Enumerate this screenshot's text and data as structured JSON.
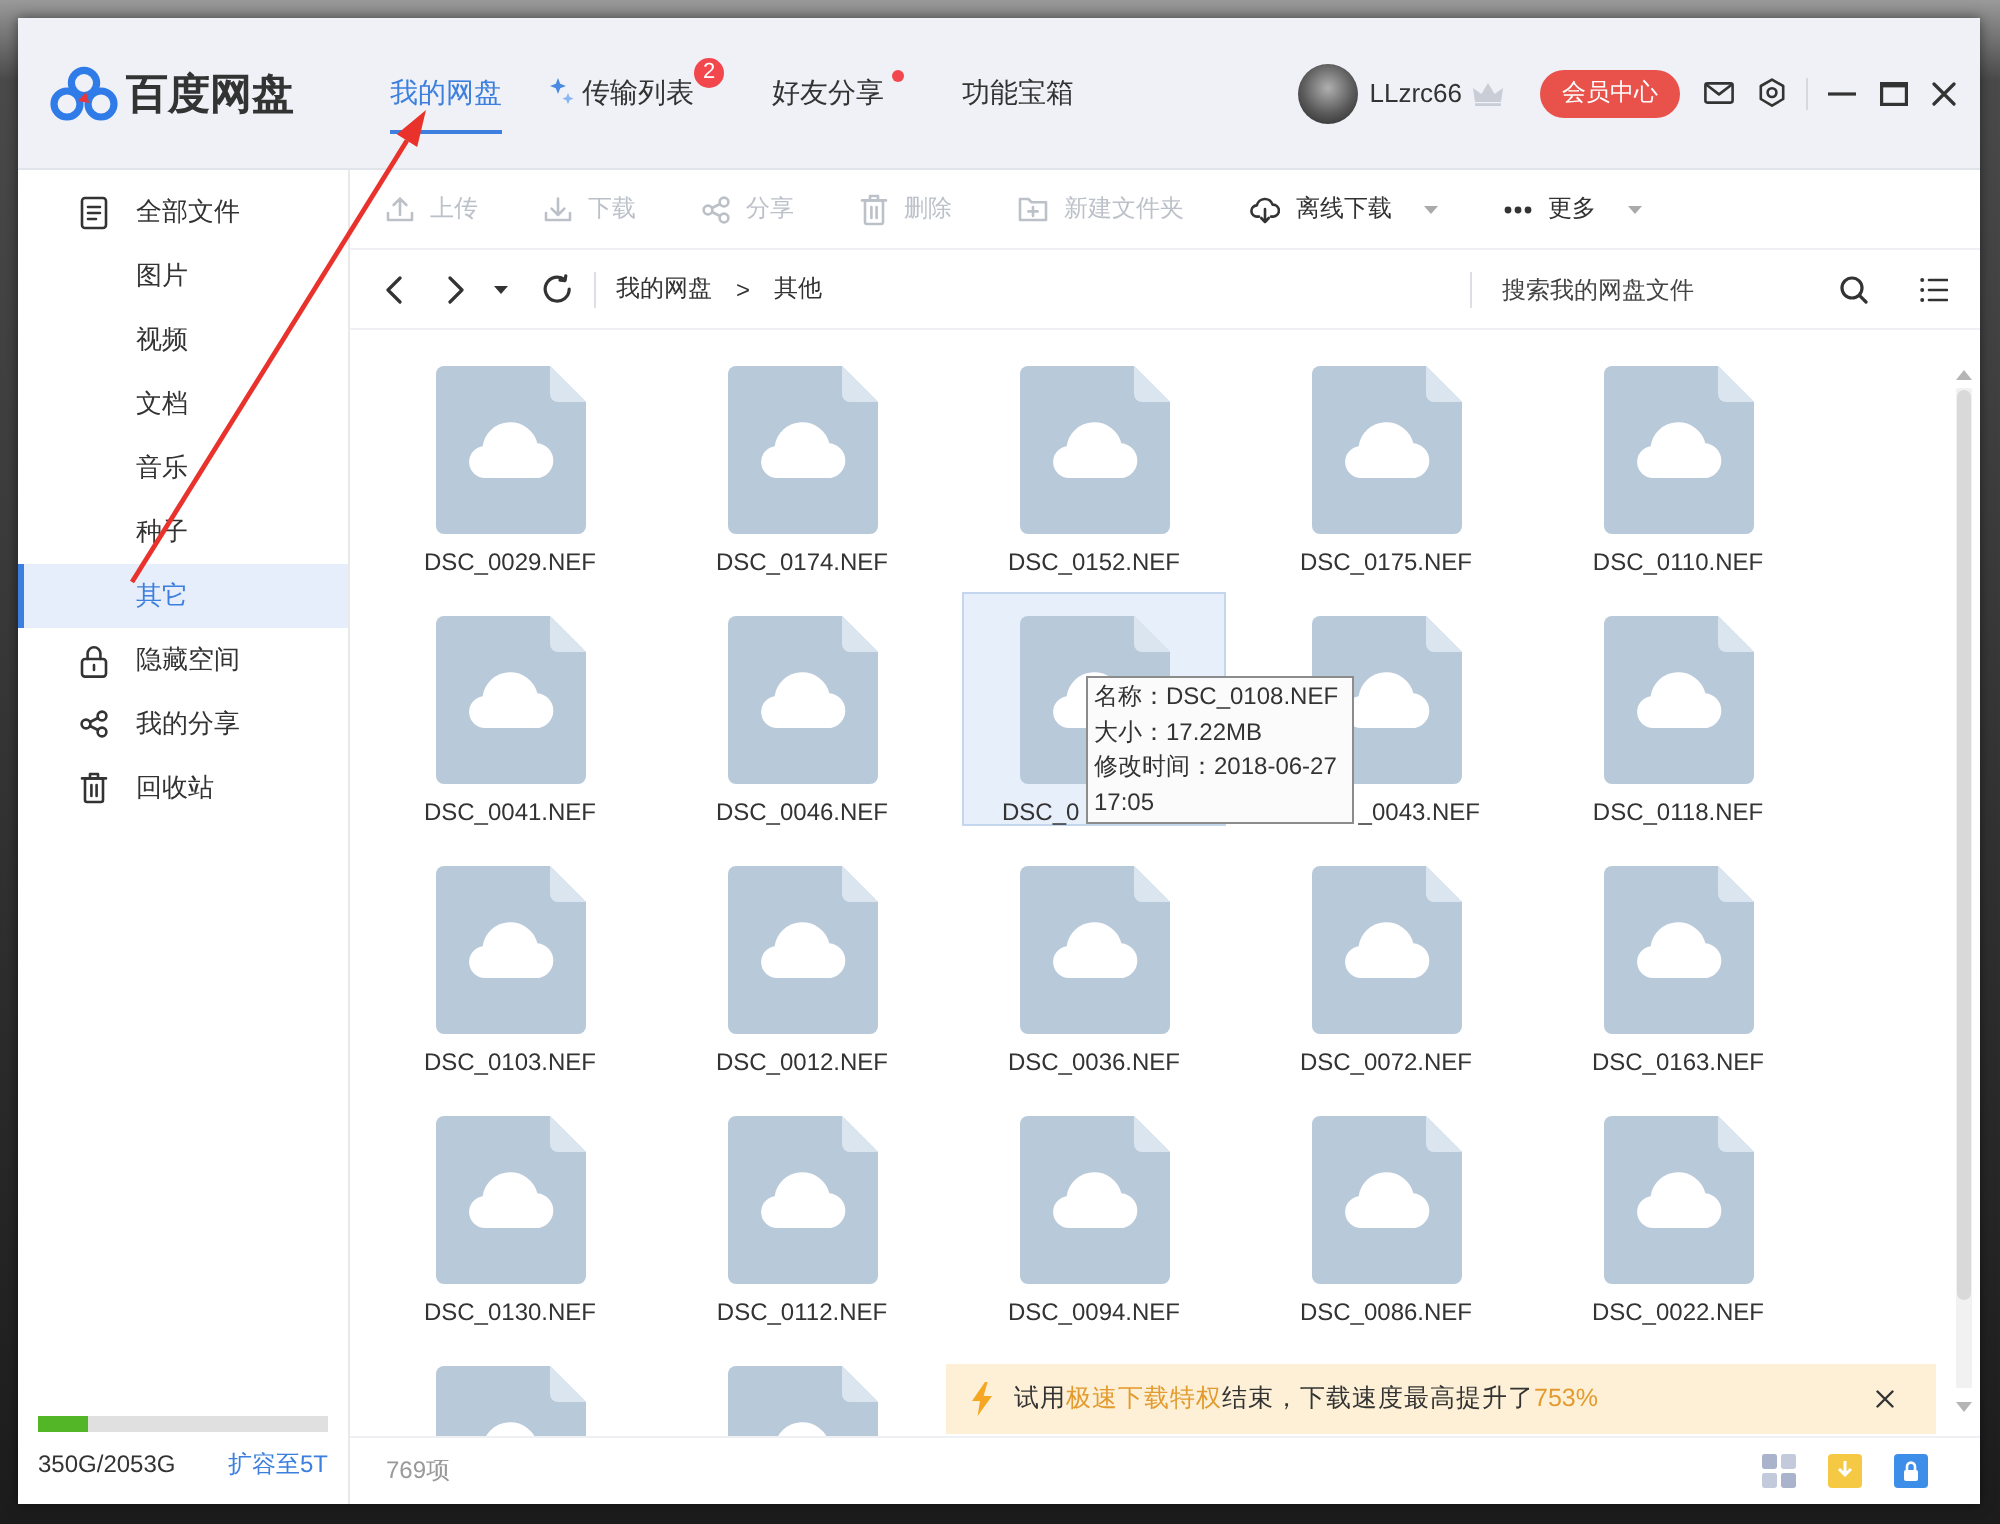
{
  "header": {
    "logo": "百度网盘",
    "tabs": [
      {
        "label": "我的网盘",
        "selected": true,
        "icon": false,
        "dot": false
      },
      {
        "label": "传输列表",
        "selected": false,
        "icon": true,
        "badge": "2",
        "dot": false
      },
      {
        "label": "好友分享",
        "selected": false,
        "icon": false,
        "dot": true
      },
      {
        "label": "功能宝箱",
        "selected": false,
        "icon": false,
        "dot": false
      }
    ],
    "user": {
      "name": "LLzrc66"
    },
    "vip_button": "会员中心"
  },
  "sidebar": {
    "items": [
      {
        "label": "全部文件",
        "selected": false,
        "children": [
          {
            "label": "图片",
            "selected": false
          },
          {
            "label": "视频",
            "selected": false
          },
          {
            "label": "文档",
            "selected": false
          },
          {
            "label": "音乐",
            "selected": false
          },
          {
            "label": "种子",
            "selected": false
          },
          {
            "label": "其它",
            "selected": true
          }
        ]
      },
      {
        "label": "隐藏空间",
        "selected": false
      },
      {
        "label": "我的分享",
        "selected": false
      },
      {
        "label": "回收站",
        "selected": false
      }
    ],
    "storage": {
      "level": 0.17,
      "usage": "350G/2053G",
      "upgrade_link": "扩容至5T"
    }
  },
  "toolbar": [
    {
      "label": "上传",
      "disabled": true,
      "dropdown": false
    },
    {
      "label": "下载",
      "disabled": true,
      "dropdown": false
    },
    {
      "label": "分享",
      "disabled": true,
      "dropdown": false
    },
    {
      "label": "删除",
      "disabled": true,
      "dropdown": false
    },
    {
      "label": "新建文件夹",
      "disabled": true,
      "dropdown": false
    },
    {
      "label": "离线下载",
      "disabled": false,
      "dropdown": true
    },
    {
      "label": "更多",
      "disabled": false,
      "dropdown": true
    }
  ],
  "navigation": {
    "breadcrumb": [
      "我的网盘",
      "其他"
    ],
    "separator": ">",
    "search": {
      "placeholder": "搜索我的网盘文件"
    }
  },
  "files": [
    {
      "name": "DSC_0029.NEF",
      "hovered": false
    },
    {
      "name": "DSC_0174.NEF",
      "hovered": false
    },
    {
      "name": "DSC_0152.NEF",
      "hovered": false
    },
    {
      "name": "DSC_0175.NEF",
      "hovered": false
    },
    {
      "name": "DSC_0110.NEF",
      "hovered": false
    },
    {
      "name": "DSC_0041.NEF",
      "hovered": false
    },
    {
      "name": "DSC_0046.NEF",
      "hovered": false
    },
    {
      "name": "DSC_0",
      "hovered": true,
      "tooltip": [
        "名称：DSC_0108.NEF",
        "大小：17.22MB",
        "修改时间：2018-06-27 17:05"
      ]
    },
    {
      "name": "_0043.NEF",
      "hovered": false
    },
    {
      "name": "DSC_0118.NEF",
      "hovered": false
    },
    {
      "name": "DSC_0103.NEF",
      "hovered": false
    },
    {
      "name": "DSC_0012.NEF",
      "hovered": false
    },
    {
      "name": "DSC_0036.NEF",
      "hovered": false
    },
    {
      "name": "DSC_0072.NEF",
      "hovered": false
    },
    {
      "name": "DSC_0163.NEF",
      "hovered": false
    },
    {
      "name": "DSC_0130.NEF",
      "hovered": false
    },
    {
      "name": "DSC_0112.NEF",
      "hovered": false
    },
    {
      "name": "DSC_0094.NEF",
      "hovered": false
    },
    {
      "name": "DSC_0086.NEF",
      "hovered": false
    },
    {
      "name": "DSC_0022.NEF",
      "hovered": false
    },
    {
      "hovered": false
    },
    {
      "hovered": false
    }
  ],
  "banner": {
    "segments": [
      {
        "text": "试用",
        "highlight": false
      },
      {
        "text": "极速下载特权",
        "highlight": true
      },
      {
        "text": "结束，下载速度最高提升了",
        "highlight": false
      },
      {
        "text": "753%",
        "highlight": true
      }
    ]
  },
  "status_bar": {
    "count": "769项"
  }
}
